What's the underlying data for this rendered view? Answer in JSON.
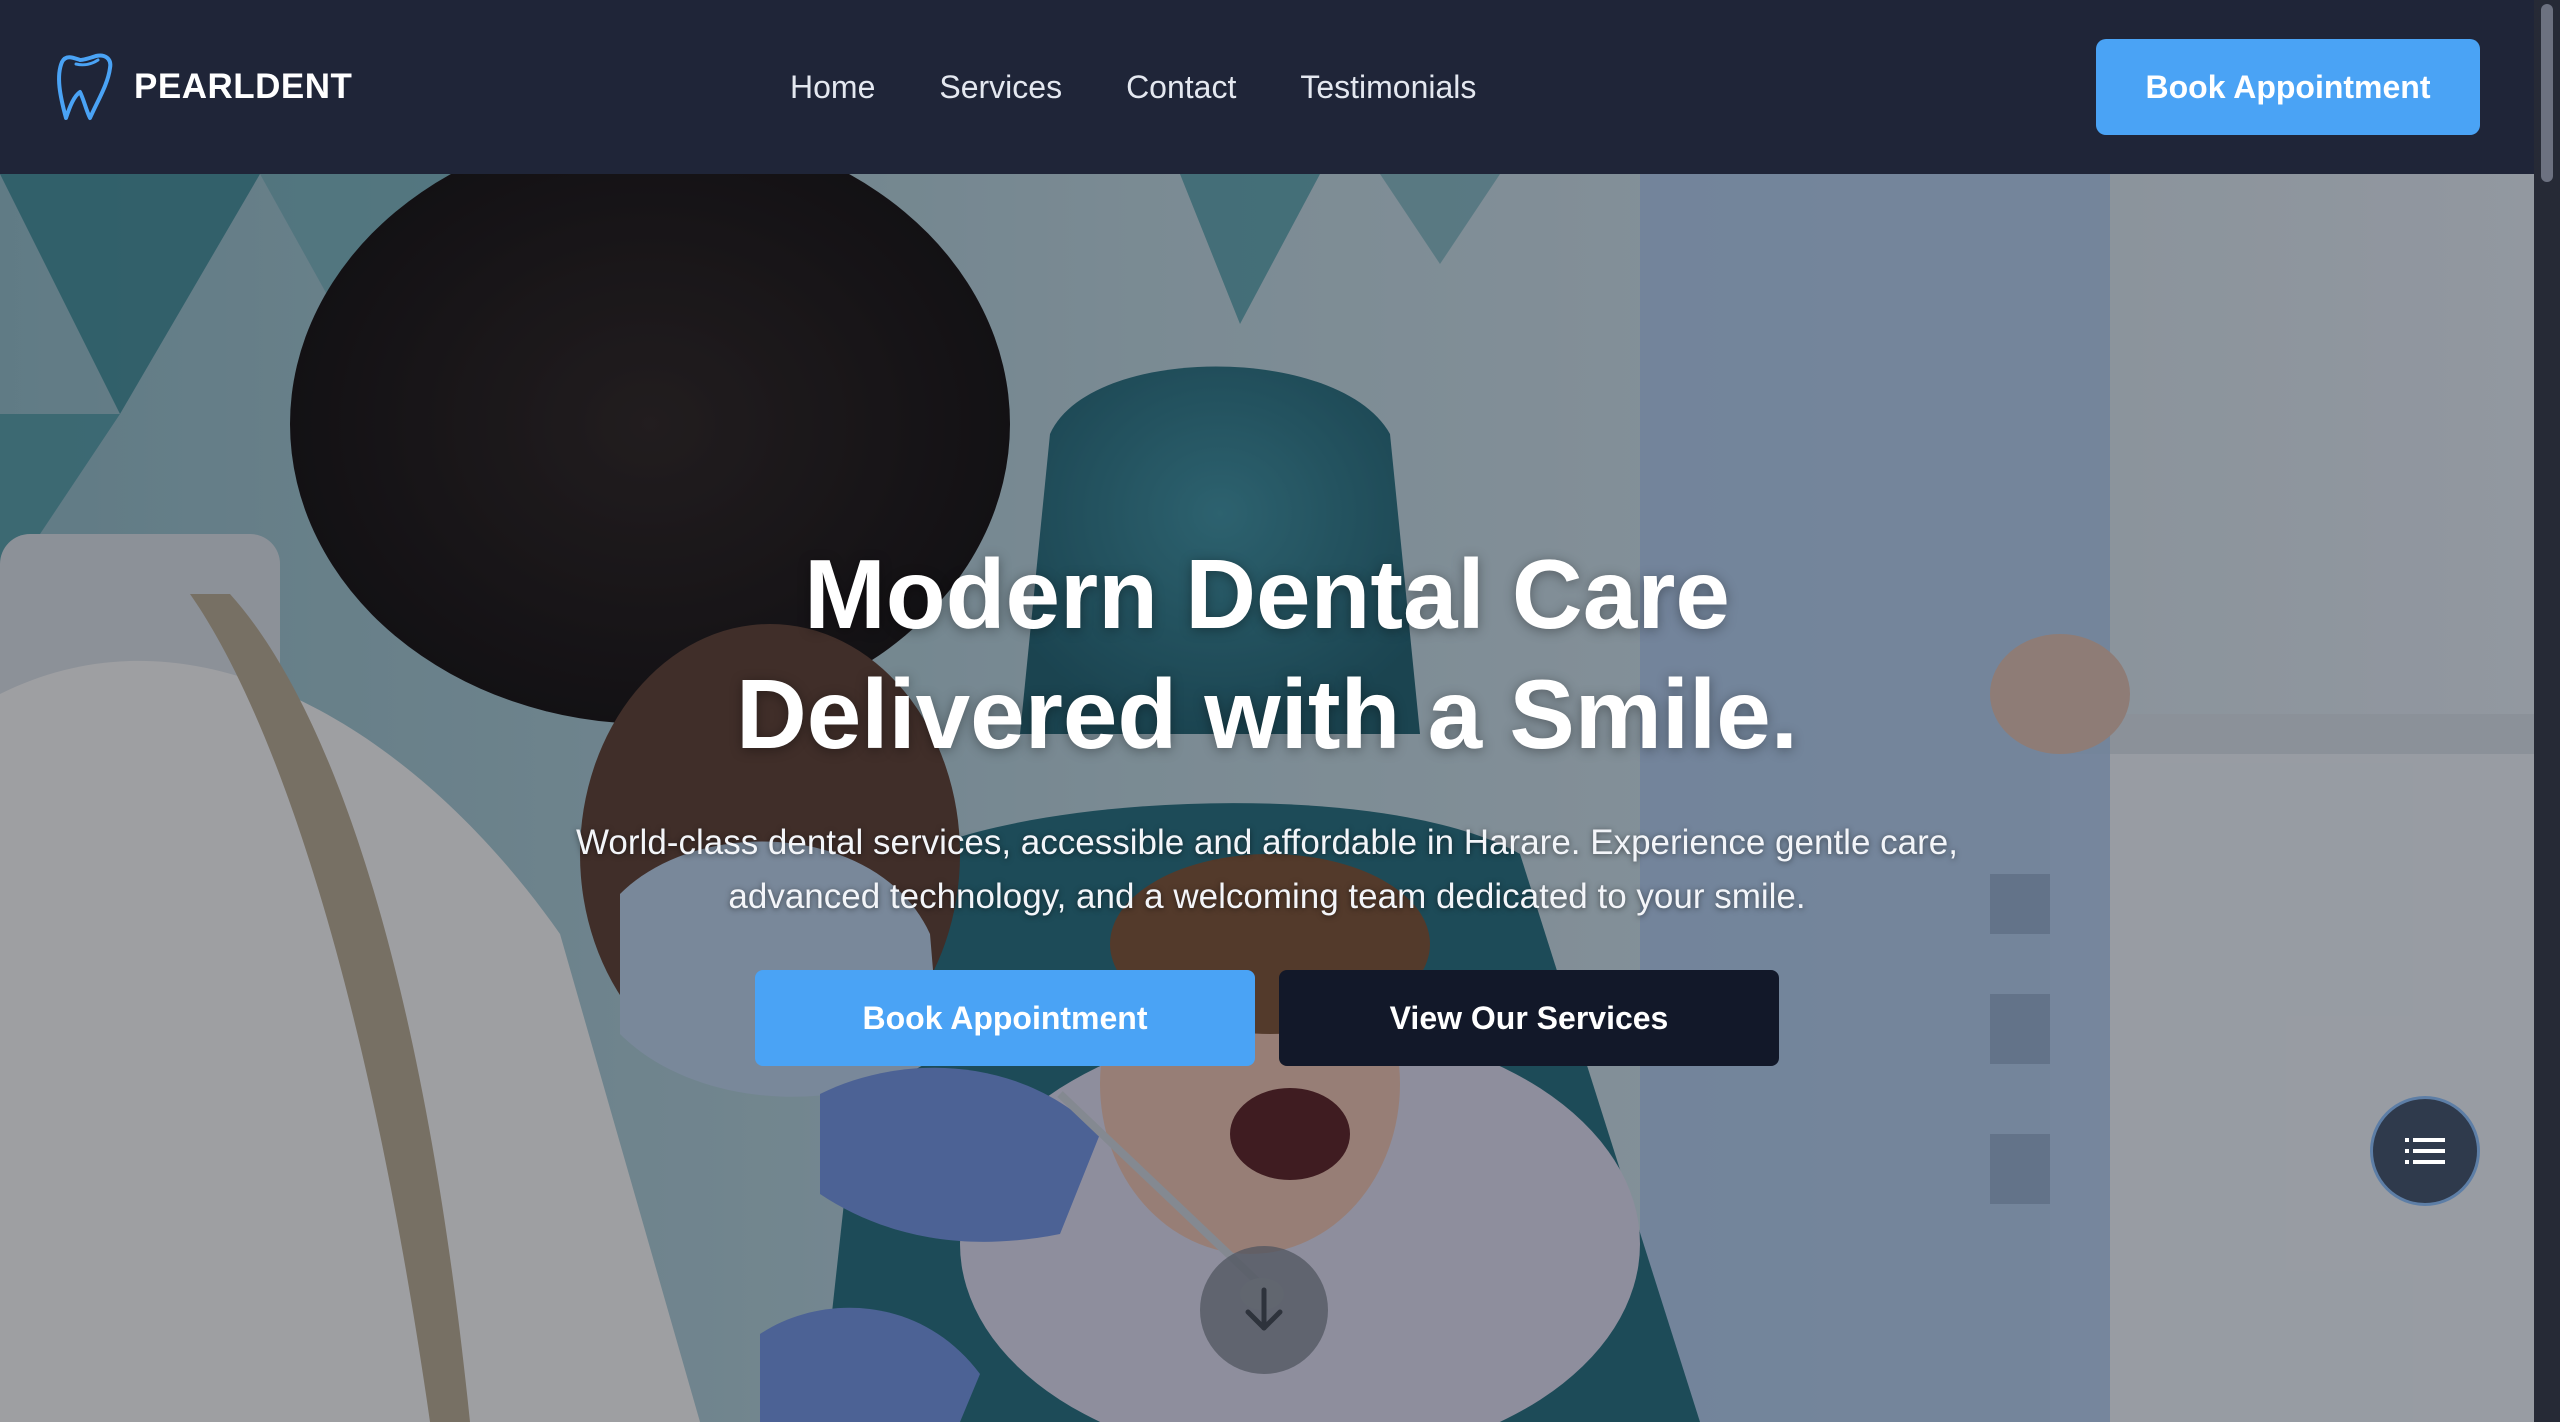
{
  "brand": {
    "name": "PEARLDENT",
    "accent_color": "#4aa3f5",
    "header_bg": "#1f2538",
    "logo_icon": "tooth-icon"
  },
  "nav": {
    "items": [
      {
        "label": "Home"
      },
      {
        "label": "Services"
      },
      {
        "label": "Contact"
      },
      {
        "label": "Testimonials"
      }
    ]
  },
  "header": {
    "cta_label": "Book Appointment"
  },
  "hero": {
    "title_line1": "Modern Dental Care",
    "title_line2": "Delivered with a Smile.",
    "subtitle": "World-class dental services, accessible and affordable in Harare. Experience gentle care, advanced technology, and a welcoming team dedicated to your smile.",
    "primary_button": "Book Appointment",
    "secondary_button": "View Our Services",
    "secondary_button_color": "#121829",
    "scroll_icon": "arrow-down-icon",
    "background_image": "dentist-examining-child-photo"
  },
  "floating": {
    "toc_icon": "list-icon"
  }
}
